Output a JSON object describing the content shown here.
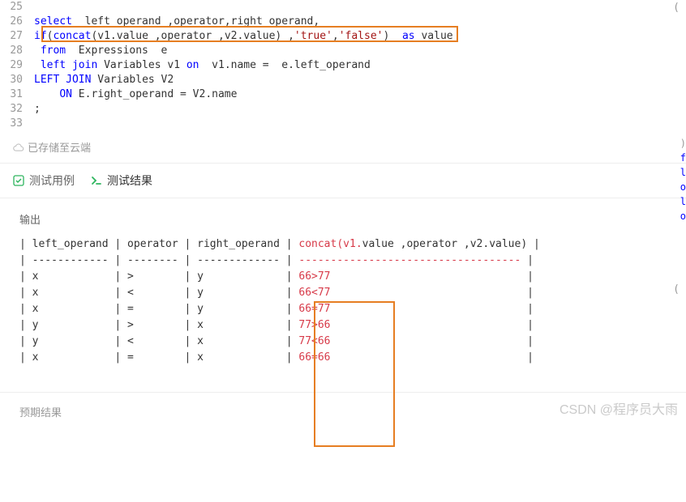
{
  "editor": {
    "lines": [
      {
        "num": "25",
        "tokens": []
      },
      {
        "num": "26",
        "tokens": [
          {
            "t": "kw",
            "v": "select"
          },
          {
            "t": "",
            "v": "  left_operand ,operator,right_operand,"
          }
        ]
      },
      {
        "num": "27",
        "tokens": [
          {
            "t": "fn",
            "v": "if"
          },
          {
            "t": "",
            "v": "("
          },
          {
            "t": "fn",
            "v": "concat"
          },
          {
            "t": "",
            "v": "(v1.value ,operator ,v2.value) ,"
          },
          {
            "t": "str",
            "v": "'true'"
          },
          {
            "t": "",
            "v": ","
          },
          {
            "t": "str",
            "v": "'false'"
          },
          {
            "t": "",
            "v": ")  "
          },
          {
            "t": "kw",
            "v": "as"
          },
          {
            "t": "",
            "v": " value"
          }
        ],
        "highlight": true
      },
      {
        "num": "28",
        "tokens": [
          {
            "t": "",
            "v": " "
          },
          {
            "t": "kw",
            "v": "from"
          },
          {
            "t": "",
            "v": "  Expressions  e"
          }
        ]
      },
      {
        "num": "29",
        "tokens": [
          {
            "t": "",
            "v": " "
          },
          {
            "t": "kw",
            "v": "left"
          },
          {
            "t": "",
            "v": " "
          },
          {
            "t": "kw",
            "v": "join"
          },
          {
            "t": "",
            "v": " Variables v1 "
          },
          {
            "t": "kw",
            "v": "on"
          },
          {
            "t": "",
            "v": "  v1.name =  e.left_operand"
          }
        ]
      },
      {
        "num": "30",
        "tokens": [
          {
            "t": "kw",
            "v": "LEFT"
          },
          {
            "t": "",
            "v": " "
          },
          {
            "t": "kw",
            "v": "JOIN"
          },
          {
            "t": "",
            "v": " Variables V2"
          }
        ]
      },
      {
        "num": "31",
        "tokens": [
          {
            "t": "",
            "v": "    "
          },
          {
            "t": "kw",
            "v": "ON"
          },
          {
            "t": "",
            "v": " E.right_operand = V2.name"
          }
        ]
      },
      {
        "num": "32",
        "tokens": [
          {
            "t": "",
            "v": ";"
          }
        ]
      },
      {
        "num": "33",
        "tokens": []
      }
    ]
  },
  "cloud_status": "已存储至云端",
  "tabs": {
    "testcase": "测试用例",
    "result": "测试结果"
  },
  "output_label": "输出",
  "output": {
    "header": "| left_operand | operator | right_operand | ",
    "header_red": "concat(v1.",
    "header_rest": "value ,operator ,v2.value)",
    "header_end": " |",
    "divider": "| ------------ | -------- | ------------- | ",
    "divider_red": "-----------------------------------",
    "divider_end": " |",
    "rows": [
      {
        "l": "x",
        "o": ">",
        "r": "y",
        "c": "66>77"
      },
      {
        "l": "x",
        "o": "<",
        "r": "y",
        "c": "66<77"
      },
      {
        "l": "x",
        "o": "=",
        "r": "y",
        "c": "66=77"
      },
      {
        "l": "y",
        "o": ">",
        "r": "x",
        "c": "77>66"
      },
      {
        "l": "y",
        "o": "<",
        "r": "x",
        "c": "77<66"
      },
      {
        "l": "x",
        "o": "=",
        "r": "x",
        "c": "66=66"
      }
    ]
  },
  "expected_label": "预期结果",
  "watermark": "CSDN @程序员大雨",
  "side": {
    "paren": "(",
    "close_paren": ")",
    "f": "f",
    "l1": "l",
    "o1": "o",
    "l2": "l",
    "o2": "o",
    "result_paren": "("
  }
}
